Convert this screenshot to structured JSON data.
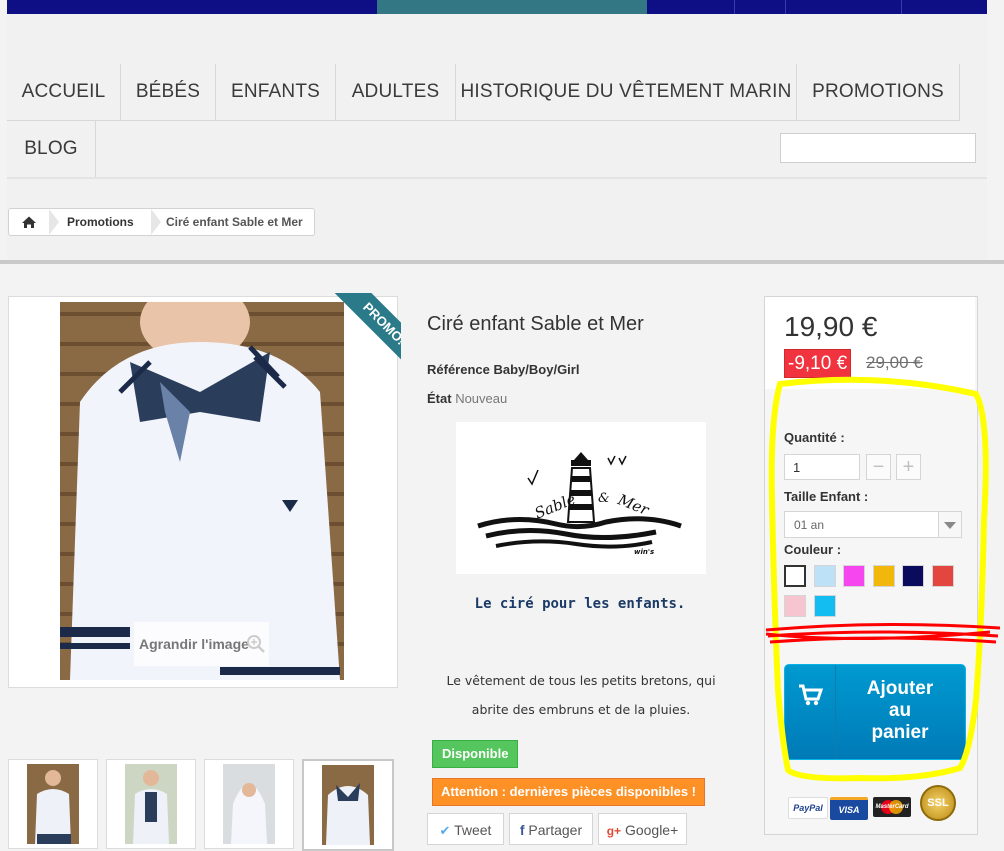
{
  "menu": {
    "items": [
      "ACCUEIL",
      "BÉBÉS",
      "ENFANTS",
      "ADULTES",
      "HISTORIQUE DU VÊTEMENT MARIN",
      "PROMOTIONS",
      "BLOG"
    ],
    "search_placeholder": ""
  },
  "breadcrumb": {
    "home_icon": "home-icon",
    "items": [
      "Promotions",
      "Ciré enfant Sable et Mer"
    ]
  },
  "gallery": {
    "promo_badge": "PROMO!",
    "enlarge_label": "Agrandir l'image",
    "thumbnails_count": 4
  },
  "product": {
    "title": "Ciré enfant Sable et Mer",
    "reference_label": "Référence",
    "reference_value": "Baby/Boy/Girl",
    "condition_label": "État",
    "condition_value": "Nouveau",
    "brand_logo_text": {
      "left": "Sable",
      "amp": "&",
      "right": "Mer",
      "sub": "win's"
    },
    "tagline": "Le ciré pour les enfants.",
    "description_line1": "Le vêtement de tous les petits bretons, qui",
    "description_line2": "abrite des embruns et de la pluies.",
    "availability": "Disponible",
    "warning": "Attention : dernières pièces disponibles !",
    "share": {
      "tweet": "Tweet",
      "facebook": "Partager",
      "google": "Google+"
    }
  },
  "buybox": {
    "price": "19,90 €",
    "discount": "-9,10 €",
    "old_price": "29,00 €",
    "quantity_label": "Quantité :",
    "quantity_value": "1",
    "size_label": "Taille Enfant :",
    "size_value": "01 an",
    "color_label": "Couleur :",
    "colors": [
      "#ffffff",
      "#bde2f8",
      "#f546ef",
      "#f1b70b",
      "#0b0b5e",
      "#e2463f",
      "#f7c5cf",
      "#13bcf1"
    ],
    "add_to_cart": [
      "Ajouter",
      "au",
      "panier"
    ],
    "payment": [
      "PayPal",
      "VISA",
      "MasterCard",
      "SSL"
    ]
  },
  "colors": {
    "topbar": "#0e0e85",
    "topbar_active": "#347784",
    "highlight": "#ffff00",
    "scribble": "#ff0000",
    "cart": "#0085c6"
  }
}
